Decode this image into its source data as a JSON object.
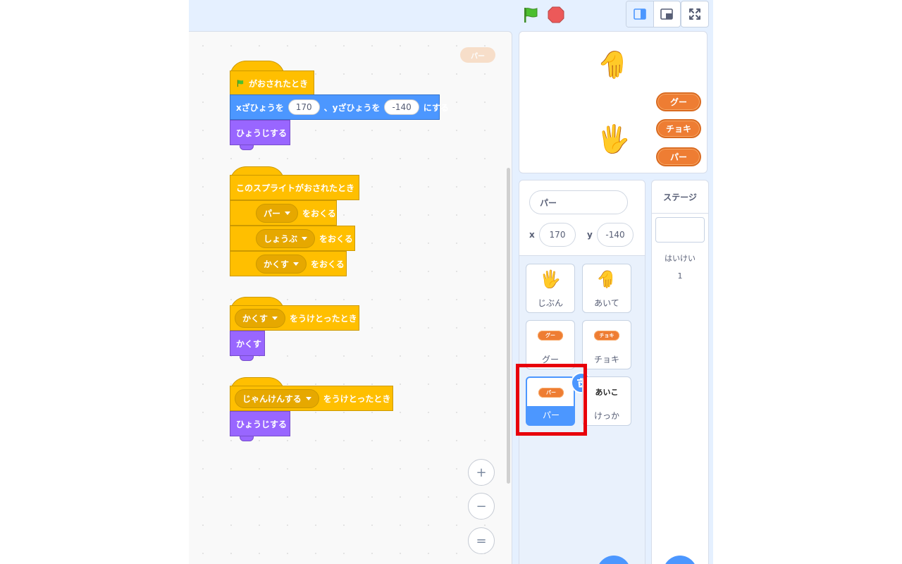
{
  "code_area": {
    "watermark_label": "パー",
    "script1": {
      "hat_label": "がおされたとき",
      "goto_prefix": "xざひょうを",
      "goto_x": "170",
      "goto_mid": "、yざひょうを",
      "goto_y": "-140",
      "goto_suffix": "にする",
      "show_label": "ひょうじする"
    },
    "script2": {
      "hat_label": "このスプライトがおされたとき",
      "broadcast1_value": "パー",
      "broadcast2_value": "しょうぶ",
      "broadcast3_value": "かくす",
      "broadcast_suffix": "をおくる"
    },
    "script3": {
      "hat_value": "かくす",
      "hat_suffix": "をうけとったとき",
      "hide_label": "かくす"
    },
    "script4": {
      "hat_value": "じゃんけんする",
      "hat_suffix": "をうけとったとき",
      "show_label": "ひょうじする"
    },
    "zoom_in": "+",
    "zoom_out": "−",
    "zoom_reset": "="
  },
  "stage": {
    "buttons": [
      "グー",
      "チョキ",
      "パー"
    ]
  },
  "sprite_info": {
    "name": "パー",
    "x_label": "x",
    "x_value": "170",
    "y_label": "y",
    "y_value": "-140"
  },
  "sprites": [
    {
      "label": "じぶん",
      "thumb": "hand-icon"
    },
    {
      "label": "あいて",
      "thumb": "hand-down-icon"
    },
    {
      "label": "グー",
      "thumb": "button-icon",
      "thumb_text": "グー"
    },
    {
      "label": "チョキ",
      "thumb": "button-icon",
      "thumb_text": "チョキ"
    },
    {
      "label": "パー",
      "thumb": "button-icon",
      "thumb_text": "パー",
      "selected": true
    },
    {
      "label": "けっか",
      "thumb_text": "あいこ"
    }
  ],
  "stage_pane": {
    "header": "ステージ",
    "backdrops_label": "はいけい",
    "backdrops_count": "1"
  },
  "colors": {
    "event": "#ffbf00",
    "motion": "#4c97ff",
    "looks": "#9966ff",
    "button_orange": "#ee7d33",
    "highlight": "#e8000b"
  }
}
